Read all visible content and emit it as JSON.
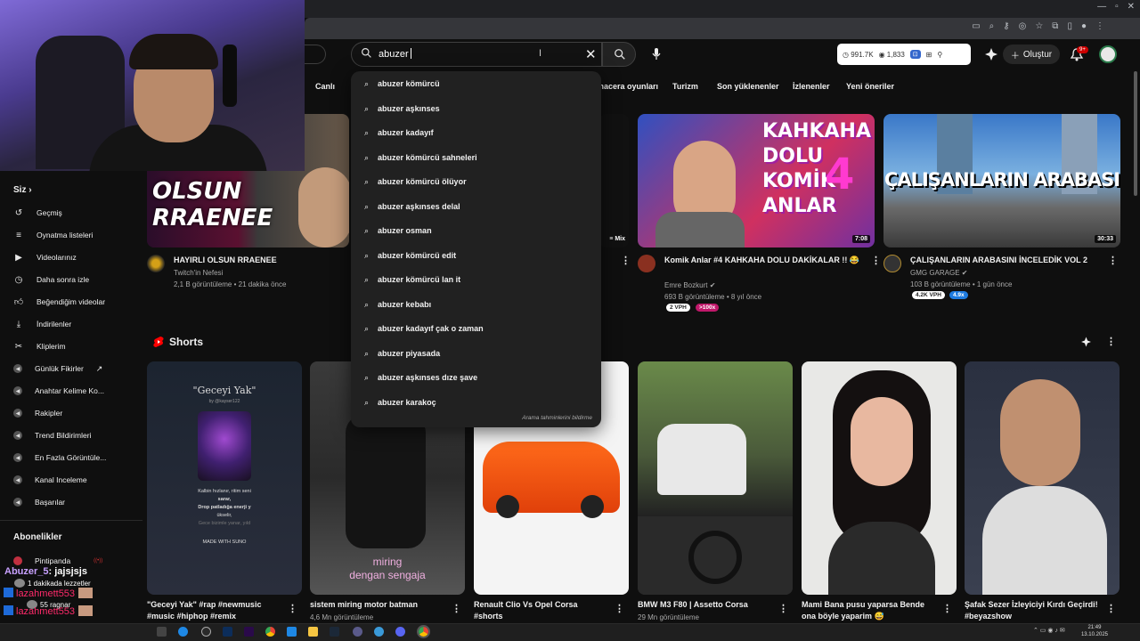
{
  "search": {
    "query": "abuzer",
    "suggestions": [
      "abuzer kömürcü",
      "abuzer aşkınses",
      "abuzer kadayıf",
      "abuzer kömürcü sahneleri",
      "abuzer kömürcü ölüyor",
      "abuzer aşkınses delal",
      "abuzer osman",
      "abuzer kömürcü edit",
      "abuzer kömürcü lan it",
      "abuzer kebabı",
      "abuzer kadayıf çak o zaman",
      "abuzer piyasada",
      "abuzer aşkınses dıze şave",
      "abuzer karakoç"
    ],
    "report_label": "Arama tahminlerini bildirme"
  },
  "header": {
    "stats": {
      "views": "991.7K",
      "watching": "1,833"
    },
    "create_label": "Oluştur",
    "notification_count": "9+"
  },
  "chips": [
    "Canlı",
    "macera oyunları",
    "Turizm",
    "Son yüklenenler",
    "İzlenenler",
    "Yeni öneriler"
  ],
  "sidebar": {
    "you_label": "Siz",
    "items": [
      {
        "label": "Geçmiş",
        "icon": "history-icon"
      },
      {
        "label": "Oynatma listeleri",
        "icon": "playlist-icon"
      },
      {
        "label": "Videolarınız",
        "icon": "video-icon"
      },
      {
        "label": "Daha sonra izle",
        "icon": "clock-icon"
      },
      {
        "label": "Beğendiğim videolar",
        "icon": "thumbs-up-icon"
      },
      {
        "label": "İndirilenler",
        "icon": "download-icon"
      },
      {
        "label": "Kliplerim",
        "icon": "scissors-icon"
      },
      {
        "label": "Günlük Fikirler",
        "icon": "extension-icon"
      },
      {
        "label": "Anahtar Kelime Ko...",
        "icon": "extension-icon"
      },
      {
        "label": "Rakipler",
        "icon": "extension-icon"
      },
      {
        "label": "Trend Bildirimleri",
        "icon": "extension-icon"
      },
      {
        "label": "En Fazla Görüntüle...",
        "icon": "extension-icon"
      },
      {
        "label": "Kanal Inceleme",
        "icon": "extension-icon"
      },
      {
        "label": "Başarılar",
        "icon": "extension-icon"
      }
    ],
    "subscriptions_label": "Abonelikler",
    "subscription": "Pintipanda",
    "subscription_badge": "((•))"
  },
  "chat": {
    "lines": [
      {
        "user": "Abuzer_5",
        "text": ": jajsjsjs"
      },
      {
        "user": "",
        "text": "1 dakikada lezzetler"
      },
      {
        "user": "lazahmett553",
        "text": ""
      },
      {
        "user": "",
        "text": "55 ragnar"
      },
      {
        "user": "lazahmett553",
        "text": ""
      },
      {
        "user": "lazahmett553",
        "text": ""
      }
    ]
  },
  "videos": [
    {
      "title": "HAYIRLI OLSUN RRAENEE",
      "channel": "Twitch'in Nefesi",
      "meta": "2,1 B görüntüleme • 21 dakika önce",
      "thumb_text": [
        "OLSUN",
        "RRAENEE"
      ]
    },
    {
      "title": "Komik Anlar #4 KAHKAHA DOLU DAKİKALAR !! 😂",
      "channel": "Emre Bozkurt",
      "meta": "693 B görüntüleme • 8 yıl önce",
      "duration": "7:08",
      "badges": [
        "2 VPH",
        ">100x"
      ],
      "thumb_text": [
        "KAHKAHA",
        "DOLU",
        "KOMİK",
        "ANLAR",
        "4"
      ]
    },
    {
      "title": "ÇALIŞANLARIN ARABASINI İNCELEDİK VOL 2",
      "channel": "GMG GARAGE",
      "meta": "103 B görüntüleme • 1 gün önce",
      "duration": "30:33",
      "badges": [
        "4.2K VPH",
        "4.9x"
      ],
      "thumb_text": [
        "ÇALIŞANLARIN ARABASI"
      ]
    }
  ],
  "mix_label": "Mix",
  "shorts": {
    "title": "Shorts",
    "items": [
      {
        "title": "\"Geceyi Yak\" #rap #newmusic #music #hiphop #remix",
        "meta": "",
        "overlay_title": "\"Geceyi Yak\"",
        "overlay_by": "by @kayser122",
        "overlay_lines": [
          "Kalbin hızlanır, ritim seni",
          "sarar,",
          "Drop patladığa enerji y",
          "ükselir,",
          "Gece bizimle yanar, yıld"
        ],
        "overlay_footer": "MADE WITH SUNO"
      },
      {
        "title": "sistem miring motor batman",
        "meta": "4,6 Mn görüntüleme",
        "overlay_lines": [
          "miring",
          "dengan sengaja"
        ]
      },
      {
        "title": "Renault Clio Vs Opel Corsa #shorts",
        "meta": ""
      },
      {
        "title": "BMW M3 F80 | Assetto Corsa",
        "meta": "29 Mn görüntüleme"
      },
      {
        "title": "Mami Bana pusu yaparsa Bende ona böyle yaparim 😅",
        "meta": ""
      },
      {
        "title": "Şafak Sezer İzleyiciyi Kırdı Geçirdi! #beyazshow",
        "meta": ""
      }
    ]
  },
  "taskbar": {
    "time": "21:49",
    "date": "13.10.2025"
  },
  "colors": {
    "background": "#0f0f0f",
    "dropdown": "#212121",
    "accent_red": "#ff0000",
    "muted_text": "#aaaaaa"
  }
}
